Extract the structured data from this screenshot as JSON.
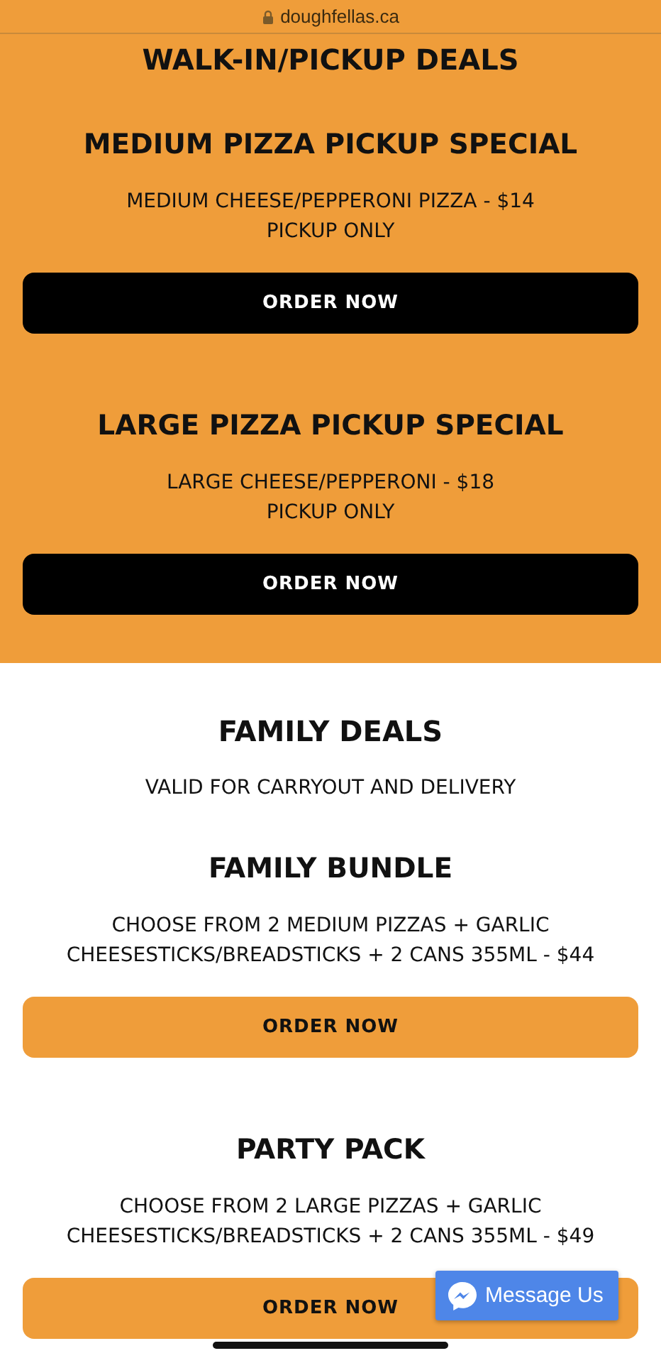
{
  "address_bar": {
    "url": "doughfellas.ca"
  },
  "sections": [
    {
      "kind": "highlight",
      "title": "WALK-IN/PICKUP DEALS",
      "deals": [
        {
          "title": "MEDIUM PIZZA PICKUP SPECIAL",
          "lines": [
            "MEDIUM CHEESE/PEPPERONI PIZZA - $14",
            "PICKUP ONLY"
          ],
          "button": "ORDER NOW"
        },
        {
          "title": "LARGE PIZZA PICKUP SPECIAL",
          "lines": [
            "LARGE CHEESE/PEPPERONI - $18",
            "PICKUP ONLY"
          ],
          "button": "ORDER NOW"
        }
      ]
    },
    {
      "kind": "plain",
      "title": "FAMILY DEALS",
      "subtitle": "VALID FOR CARRYOUT AND DELIVERY",
      "deals": [
        {
          "title": "FAMILY BUNDLE",
          "lines": [
            "CHOOSE FROM 2 MEDIUM PIZZAS + GARLIC",
            "CHEESESTICKS/BREADSTICKS + 2 CANS 355ML - $44"
          ],
          "button": "ORDER NOW"
        },
        {
          "title": "PARTY PACK",
          "lines": [
            "CHOOSE FROM 2 LARGE PIZZAS + GARLIC",
            "CHEESESTICKS/BREADSTICKS + 2 CANS 355ML - $49"
          ],
          "button": "ORDER NOW"
        }
      ]
    }
  ],
  "chat_button": {
    "label": "Message Us"
  }
}
